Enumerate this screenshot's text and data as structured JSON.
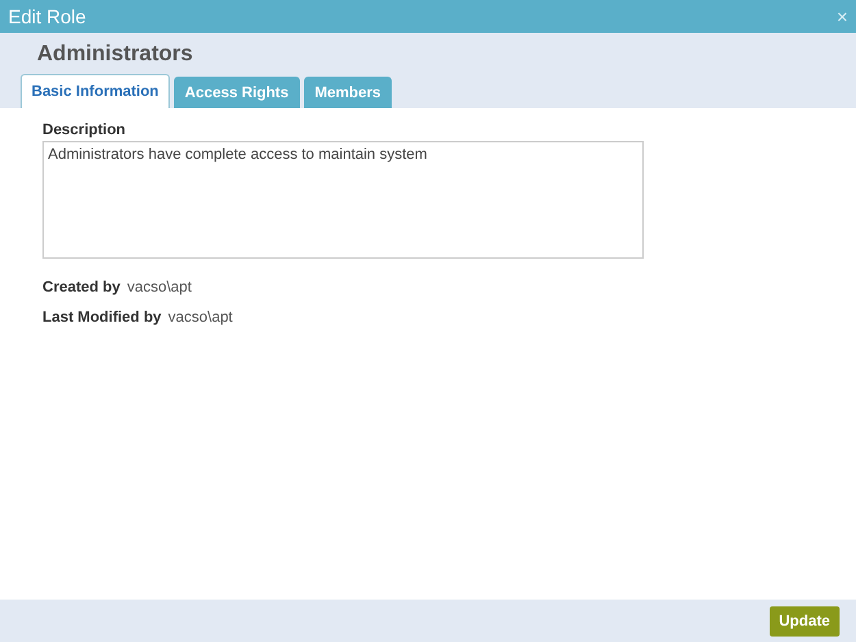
{
  "window": {
    "title": "Edit Role",
    "close": "×"
  },
  "heading": "Administrators",
  "tabs": [
    {
      "label": "Basic Information",
      "selected": true
    },
    {
      "label": "Access Rights",
      "selected": false
    },
    {
      "label": "Members",
      "selected": false
    }
  ],
  "description": {
    "label": "Description",
    "value": "Administrators have complete access to maintain system"
  },
  "info": [
    {
      "label": "Created by",
      "value": "vacso\\apt"
    },
    {
      "label": "Last Modified by",
      "value": "vacso\\apt"
    }
  ],
  "buttons": [
    "Update"
  ]
}
